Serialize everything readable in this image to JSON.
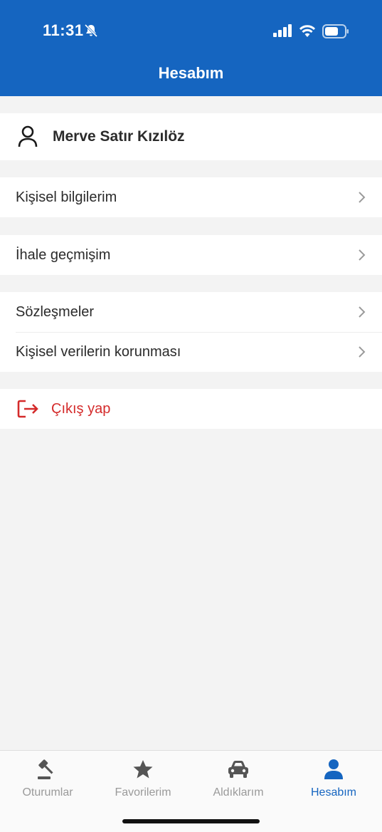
{
  "status_bar": {
    "time": "11:31"
  },
  "header": {
    "title": "Hesabım"
  },
  "profile": {
    "name": "Merve Satır Kızılöz"
  },
  "menu": {
    "personal_info": "Kişisel bilgilerim",
    "bid_history": "İhale geçmişim",
    "contracts": "Sözleşmeler",
    "data_protection": "Kişisel verilerin korunması",
    "logout": "Çıkış yap"
  },
  "tabs": [
    {
      "label": "Oturumlar",
      "icon": "gavel-icon"
    },
    {
      "label": "Favorilerim",
      "icon": "star-icon"
    },
    {
      "label": "Aldıklarım",
      "icon": "car-icon"
    },
    {
      "label": "Hesabım",
      "icon": "person-icon"
    }
  ],
  "colors": {
    "primary": "#1565c0",
    "danger": "#d42b2b",
    "background": "#f3f3f3"
  }
}
